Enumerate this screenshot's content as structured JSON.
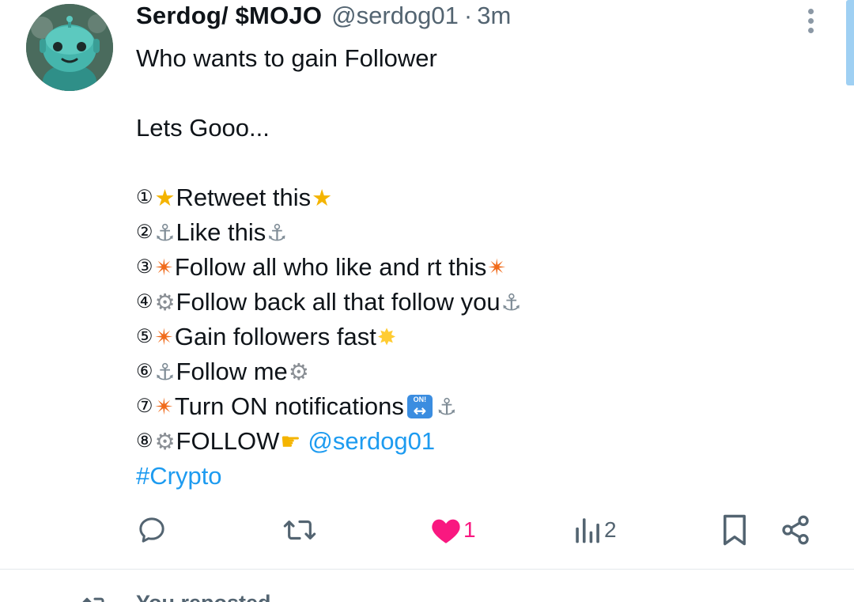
{
  "tweet": {
    "author": {
      "display_name": "Serdog/ $MOJO",
      "handle": "@serdog01",
      "separator": "·",
      "time": "3m"
    },
    "text": {
      "line1": "Who wants to gain Follower",
      "line2": "Lets Gooo...",
      "items": [
        {
          "num": "①",
          "text": "Retweet this"
        },
        {
          "num": "②",
          "text": "Like this"
        },
        {
          "num": "③",
          "text": "Follow all who like and rt this"
        },
        {
          "num": "④",
          "text": "Follow back all that follow you"
        },
        {
          "num": "⑤",
          "text": "Gain followers fast"
        },
        {
          "num": "⑥",
          "text": "Follow me"
        },
        {
          "num": "⑦",
          "text": "Turn ON notifications"
        },
        {
          "num": "⑧",
          "text": "FOLLOW"
        }
      ],
      "on_badge": "ON!",
      "mention": "@serdog01",
      "hashtag": "#Crypto"
    },
    "actions": {
      "reply_icon": "reply-icon",
      "retweet_icon": "retweet-icon",
      "like_icon": "heart-icon",
      "like_count": "1",
      "views_icon": "views-icon",
      "views_count": "2",
      "bookmark_icon": "bookmark-icon",
      "share_icon": "share-icon"
    }
  },
  "next_row": {
    "label": "You reposted"
  },
  "colors": {
    "text": "#0f1419",
    "secondary": "#536471",
    "link": "#1d9bf0",
    "like": "#f91880"
  }
}
